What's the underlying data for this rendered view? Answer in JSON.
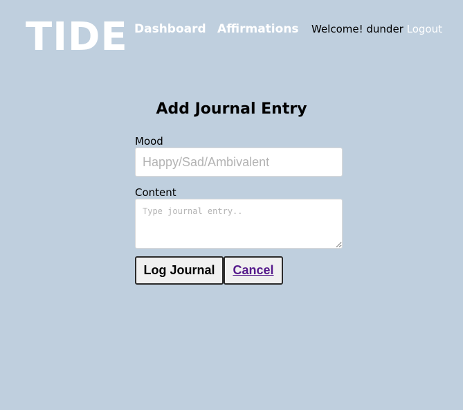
{
  "header": {
    "logo": "TIDE",
    "nav": {
      "dashboard": "Dashboard",
      "affirmations": "Affirmations"
    },
    "welcome": "Welcome! dunder",
    "logout": "Logout"
  },
  "form": {
    "title": "Add Journal Entry",
    "mood": {
      "label": "Mood",
      "placeholder": "Happy/Sad/Ambivalent",
      "value": ""
    },
    "content": {
      "label": "Content",
      "placeholder": "Type journal entry..",
      "value": ""
    },
    "submit_label": "Log Journal",
    "cancel_label": "Cancel"
  },
  "colors": {
    "background": "#bfcfde",
    "header_text": "#ffffff",
    "cancel_link": "#551a8b"
  }
}
